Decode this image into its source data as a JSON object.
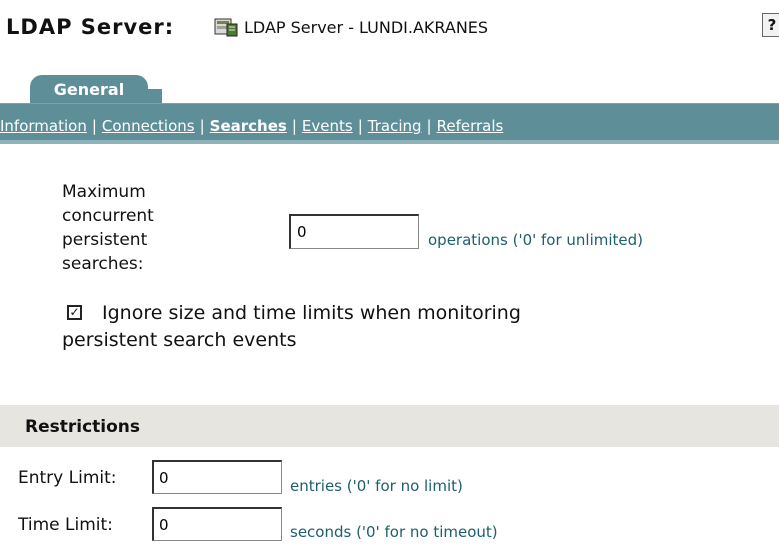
{
  "header": {
    "label": "LDAP Server:",
    "object_name": "LDAP Server - LUNDI.AKRANES",
    "help": "?"
  },
  "tab": {
    "label": "General"
  },
  "nav": {
    "items": [
      "Information",
      "Connections",
      "Searches",
      "Events",
      "Tracing",
      "Referrals"
    ],
    "active": "Searches"
  },
  "persistent": {
    "label_lines": [
      "Maximum",
      "concurrent",
      "persistent",
      "searches:"
    ],
    "value": "0",
    "hint": "operations ('0' for unlimited)"
  },
  "ignore_limits": {
    "checked": true,
    "check_mark": "✓",
    "label": "Ignore size and time limits when monitoring persistent search events"
  },
  "restrictions": {
    "title": "Restrictions",
    "entry": {
      "label": "Entry Limit:",
      "value": "0",
      "hint": "entries ('0' for no limit)"
    },
    "time": {
      "label": "Time Limit:",
      "value": "0",
      "hint": "seconds ('0' for no timeout)"
    }
  }
}
